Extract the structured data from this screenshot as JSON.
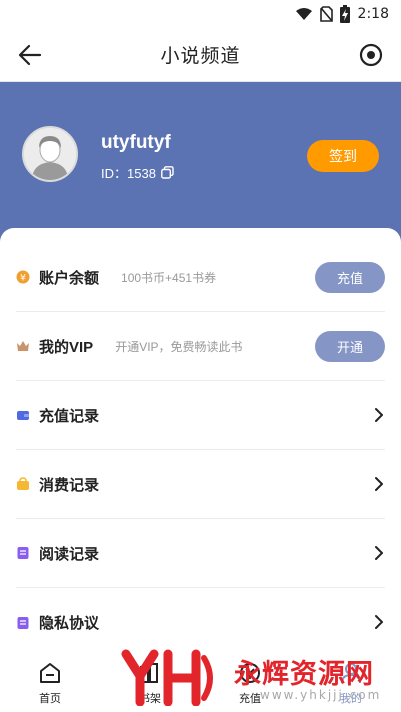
{
  "status_bar": {
    "time": "2:18",
    "icons": [
      "wifi-icon",
      "no-sim-icon",
      "battery-charging-icon"
    ]
  },
  "appbar": {
    "title": "小说频道",
    "left_icon": "back-arrow-icon",
    "right_icon": "target-icon"
  },
  "profile": {
    "username": "utyfutyf",
    "id_text": "ID：1538",
    "sign_in_label": "签到",
    "accent": "#5b72b3",
    "sign_in_color": "#ff9a00"
  },
  "menu": {
    "balance": {
      "label": "账户余额",
      "detail": "100书币+451书券",
      "button": "充值"
    },
    "vip": {
      "label": "我的VIP",
      "detail": "开通VIP，免费畅读此书",
      "button": "开通"
    },
    "recharge_records": {
      "label": "充值记录"
    },
    "consume_records": {
      "label": "消费记录"
    },
    "read_records": {
      "label": "阅读记录"
    },
    "privacy": {
      "label": "隐私协议"
    }
  },
  "tabbar": {
    "tabs": [
      {
        "label": "首页",
        "icon": "home-icon"
      },
      {
        "label": "书架",
        "icon": "bookshelf-icon"
      },
      {
        "label": "充值",
        "icon": "recharge-icon"
      },
      {
        "label": "我的",
        "icon": "profile-icon"
      }
    ],
    "active_color": "#8495c6"
  },
  "watermark": {
    "text": "永辉资源网",
    "url": "www.yhkjjj.com"
  }
}
